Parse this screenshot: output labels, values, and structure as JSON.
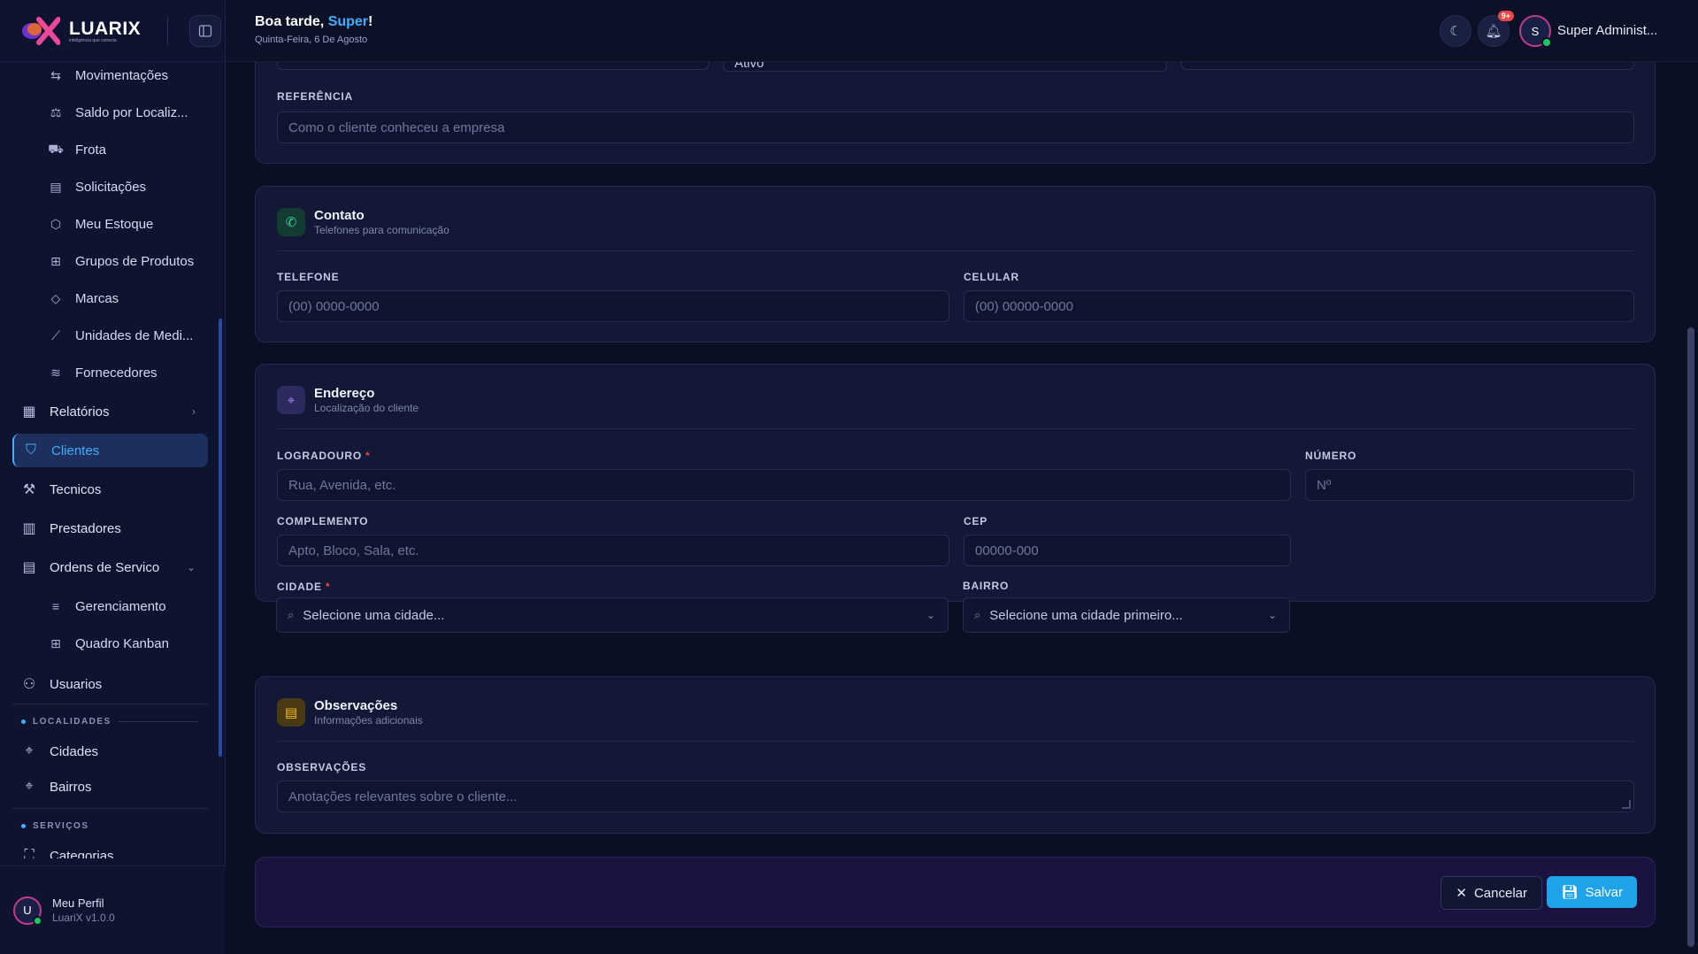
{
  "logo": {
    "name": "LUARIX",
    "tagline": "inteligência que conecta"
  },
  "topbar": {
    "greeting_prefix": "Boa tarde, ",
    "greeting_name": "Super",
    "greeting_suffix": "!",
    "date": "Quinta-Feira, 6 De Agosto",
    "notification_badge": "9+",
    "avatar_initial": "S",
    "user_name": "Super Administ..."
  },
  "sidebar": {
    "sub_items": [
      {
        "label": "Movimentações",
        "icon": "swap-icon"
      },
      {
        "label": "Saldo por Localiz...",
        "icon": "scale-icon"
      },
      {
        "label": "Frota",
        "icon": "truck-icon"
      },
      {
        "label": "Solicitações",
        "icon": "clipboard-icon"
      },
      {
        "label": "Meu Estoque",
        "icon": "box-icon"
      },
      {
        "label": "Grupos de Produtos",
        "icon": "tree-icon"
      },
      {
        "label": "Marcas",
        "icon": "tag-icon"
      },
      {
        "label": "Unidades de Medi...",
        "icon": "ruler-icon"
      },
      {
        "label": "Fornecedores",
        "icon": "layers-icon"
      }
    ],
    "relatorios": "Relatórios",
    "clientes": "Clientes",
    "tecnicos": "Tecnicos",
    "prestadores": "Prestadores",
    "ordens": "Ordens de Servico",
    "ordens_sub": [
      {
        "label": "Gerenciamento",
        "icon": "list-icon"
      },
      {
        "label": "Quadro Kanban",
        "icon": "kanban-icon"
      }
    ],
    "usuarios": "Usuarios",
    "section_localidades": "LOCALIDADES",
    "cidades": "Cidades",
    "bairros": "Bairros",
    "section_servicos": "SERVIÇOS",
    "categorias": "Categorias",
    "profile_name": "Meu Perfil",
    "profile_version": "LuariX v1.0.0",
    "profile_initial": "U"
  },
  "form": {
    "top_partial": {
      "status_value": "Ativo"
    },
    "referencia": {
      "label": "REFERÊNCIA",
      "placeholder": "Como o cliente conheceu a empresa"
    },
    "contato": {
      "title": "Contato",
      "subtitle": "Telefones para comunicação",
      "telefone_label": "TELEFONE",
      "telefone_placeholder": "(00) 0000-0000",
      "celular_label": "CELULAR",
      "celular_placeholder": "(00) 00000-0000"
    },
    "endereco": {
      "title": "Endereço",
      "subtitle": "Localização do cliente",
      "logradouro_label": "LOGRADOURO",
      "logradouro_placeholder": "Rua, Avenida, etc.",
      "numero_label": "NÚMERO",
      "numero_placeholder": "Nº",
      "complemento_label": "COMPLEMENTO",
      "complemento_placeholder": "Apto, Bloco, Sala, etc.",
      "cep_label": "CEP",
      "cep_placeholder": "00000-000",
      "cidade_label": "CIDADE",
      "cidade_value": "Selecione uma cidade...",
      "bairro_label": "BAIRRO",
      "bairro_value": "Selecione uma cidade primeiro..."
    },
    "observacoes": {
      "title": "Observações",
      "subtitle": "Informações adicionais",
      "label": "OBSERVAÇÕES",
      "placeholder": "Anotações relevantes sobre o cliente..."
    },
    "required_mark": "*"
  },
  "actions": {
    "cancel": "Cancelar",
    "save": "Salvar"
  },
  "colors": {
    "accent": "#3fb0ff",
    "save": "#1ea3e8",
    "required": "#ef4444",
    "online": "#22c55e"
  }
}
